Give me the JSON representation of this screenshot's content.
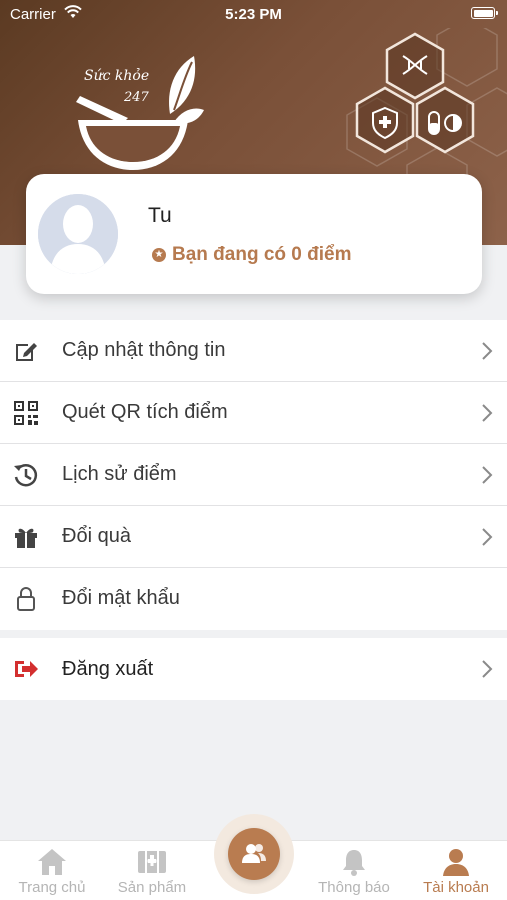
{
  "status_bar": {
    "carrier": "Carrier",
    "time": "5:23 PM"
  },
  "brand": {
    "title": "Sức khỏe",
    "subtitle": "247"
  },
  "profile": {
    "name": "Tu",
    "points_text": "Bạn đang có 0 điểm"
  },
  "menu": [
    {
      "label": "Cập nhật thông tin",
      "icon": "edit-icon",
      "chevron": true
    },
    {
      "label": "Quét QR tích điểm",
      "icon": "qr-code-icon",
      "chevron": true
    },
    {
      "label": "Lịch sử điểm",
      "icon": "history-icon",
      "chevron": true
    },
    {
      "label": "Đổi quà",
      "icon": "gift-icon",
      "chevron": true
    },
    {
      "label": "Đổi mật khẩu",
      "icon": "lock-icon",
      "chevron": false
    }
  ],
  "logout": {
    "label": "Đăng xuất",
    "icon": "logout-icon"
  },
  "tabs": [
    {
      "label": "Trang chủ",
      "icon": "home-icon",
      "active": false
    },
    {
      "label": "Sản phẩm",
      "icon": "medical-kit-icon",
      "active": false
    },
    {
      "label": "Thông báo",
      "icon": "bell-icon",
      "active": false
    },
    {
      "label": "Tài khoản",
      "icon": "user-icon",
      "active": true
    }
  ],
  "colors": {
    "accent": "#b97c50",
    "header": "#7a5038",
    "logout_icon": "#d32f2f"
  }
}
